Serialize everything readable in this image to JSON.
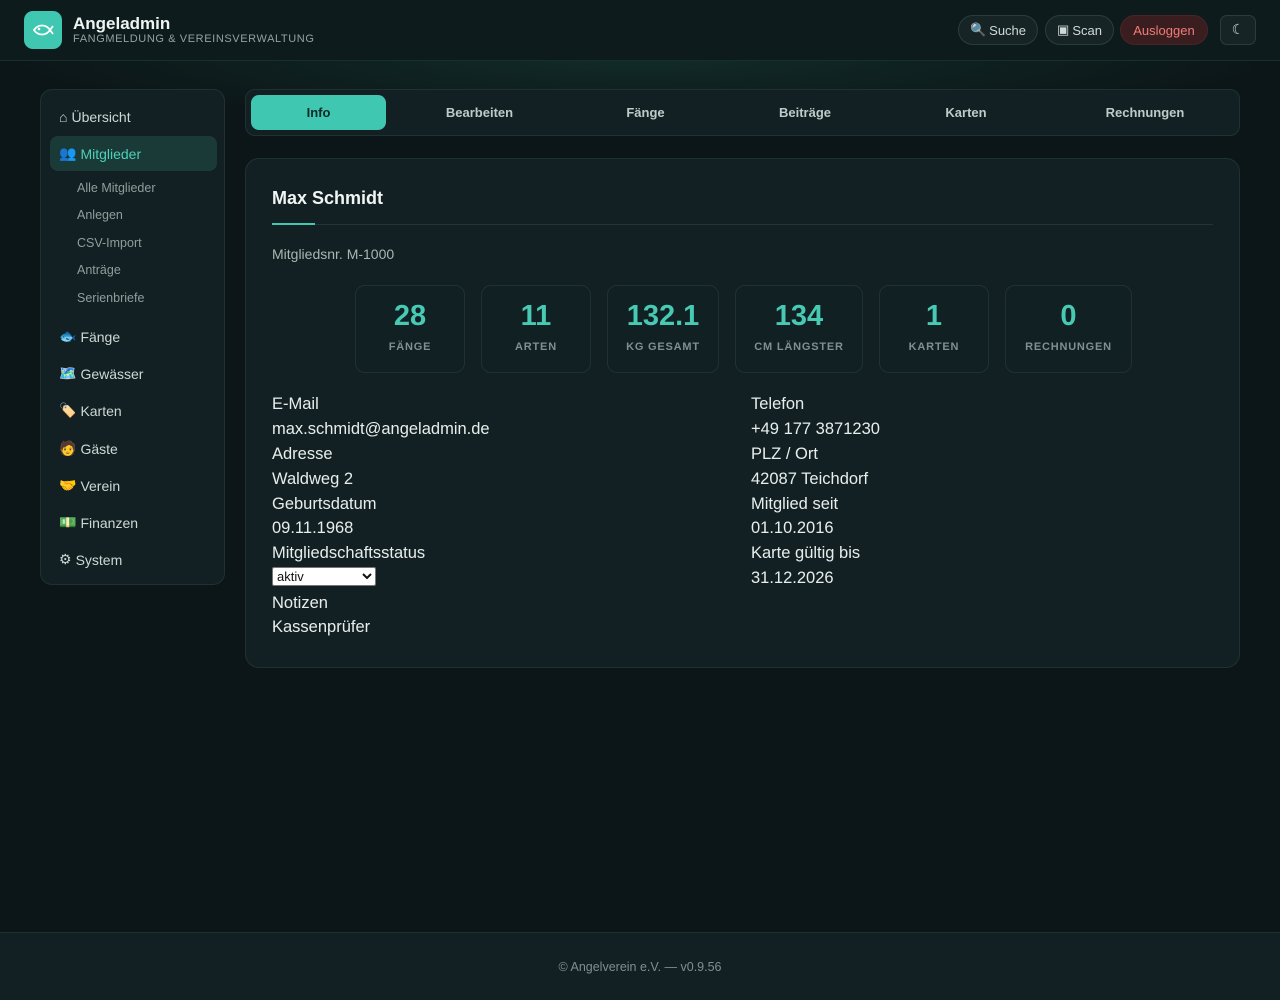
{
  "header": {
    "title": "Angeladmin",
    "subtitle": "Fangmeldung & Vereinsverwaltung",
    "logo_icon": "fish-icon",
    "search": {
      "icon": "🔍",
      "label": "Suche"
    },
    "scan": {
      "icon": "▣",
      "label": "Scan"
    },
    "logout_label": "Ausloggen",
    "theme_icon": "☾"
  },
  "sidebar": {
    "items": [
      {
        "icon": "⌂",
        "label": "Übersicht"
      },
      {
        "icon": "👥",
        "label": "Mitglieder"
      },
      {
        "icon": "🐟",
        "label": "Fänge"
      },
      {
        "icon": "🗺️",
        "label": "Gewässer"
      },
      {
        "icon": "🏷️",
        "label": "Karten"
      },
      {
        "icon": "🧑",
        "label": "Gäste"
      },
      {
        "icon": "🤝",
        "label": "Verein"
      },
      {
        "icon": "💵",
        "label": "Finanzen"
      },
      {
        "icon": "⚙",
        "label": "System"
      }
    ],
    "subitems": [
      "Alle Mitglieder",
      "Anlegen",
      "CSV-Import",
      "Anträge",
      "Serienbriefe"
    ]
  },
  "tabs": [
    "Info",
    "Bearbeiten",
    "Fänge",
    "Beiträge",
    "Karten",
    "Rechnungen"
  ],
  "member": {
    "name": "Max Schmidt",
    "number": "Mitgliedsnr. M-1000",
    "stats": [
      {
        "value": "28",
        "label": "Fänge"
      },
      {
        "value": "11",
        "label": "Arten"
      },
      {
        "value": "132.1",
        "label": "kg gesamt"
      },
      {
        "value": "134",
        "label": "cm Längster"
      },
      {
        "value": "1",
        "label": "Karten"
      },
      {
        "value": "0",
        "label": "Rechnungen"
      }
    ],
    "fields": {
      "email_label": "E-Mail",
      "email": "max.schmidt@angeladmin.de",
      "address_label": "Adresse",
      "address": "Waldweg 2",
      "birth_label": "Geburtsdatum",
      "birth": "09.11.1968",
      "status_label": "Mitgliedschaftsstatus",
      "status_value": "aktiv",
      "notes_label": "Notizen",
      "notes": "Kassenprüfer",
      "phone_label": "Telefon",
      "phone": "+49 177 3871230",
      "city_label": "PLZ / Ort",
      "city": "42087 Teichdorf",
      "since_label": "Mitglied seit",
      "since": "01.10.2016",
      "card_label": "Karte gültig bis",
      "card_valid": "31.12.2026"
    }
  },
  "footer": "© Angelverein e.V. — v0.9.56",
  "colors": {
    "accent": "#3fc7b1",
    "background": "#0c1618",
    "panel": "#132023",
    "danger": "#f07c78"
  }
}
